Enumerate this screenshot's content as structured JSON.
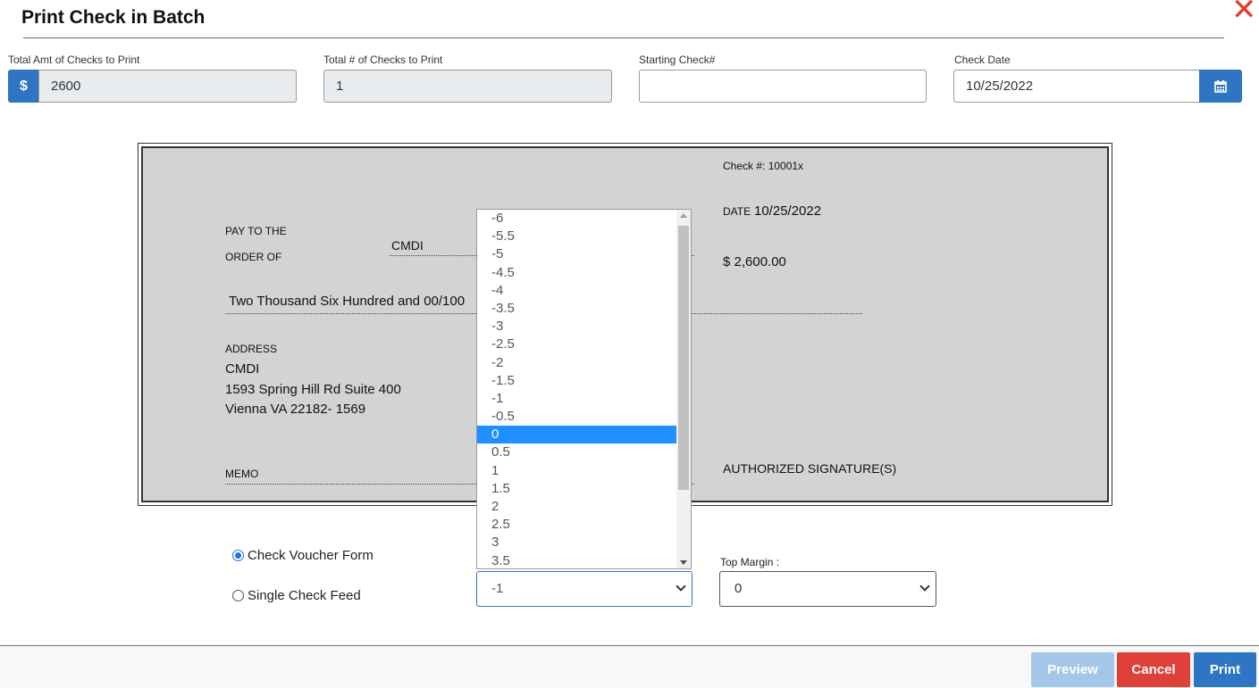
{
  "dialog": {
    "title": "Print Check in Batch",
    "close_glyph": "✕",
    "accent_color": "#2e76c4"
  },
  "fields": {
    "total_amt": {
      "label": "Total Amt of Checks to Print",
      "prefix": "$",
      "value": "2600"
    },
    "total_count": {
      "label": "Total # of Checks to Print",
      "value": "1"
    },
    "starting_check": {
      "label": "Starting Check#",
      "value": ""
    },
    "check_date": {
      "label": "Check Date",
      "value": "10/25/2022",
      "icon": "calendar-icon"
    }
  },
  "check": {
    "check_number": "Check #: 10001x",
    "date_label": "DATE",
    "date_value": "10/25/2022",
    "pay_to_line1": "PAY TO THE",
    "pay_to_line2": "ORDER OF",
    "payee": "CMDI",
    "amount": "$ 2,600.00",
    "amount_words": "Two Thousand Six Hundred and 00/100",
    "address_label": "ADDRESS",
    "address_name": "CMDI",
    "address_line1": "1593 Spring Hill Rd Suite 400",
    "address_line2": "Vienna VA 22182- 1569",
    "memo_label": "MEMO",
    "signature_label": "AUTHORIZED SIGNATURE(S)"
  },
  "options": {
    "voucher_label": "Check Voucher Form",
    "voucher_selected": true,
    "single_label": "Single Check Feed",
    "single_selected": false
  },
  "left_margin_select": {
    "value": "-1",
    "open_options": [
      "-6",
      "-5.5",
      "-5",
      "-4.5",
      "-4",
      "-3.5",
      "-3",
      "-2.5",
      "-2",
      "-1.5",
      "-1",
      "-0.5",
      "0",
      "0.5",
      "1",
      "1.5",
      "2",
      "2.5",
      "3",
      "3.5"
    ],
    "highlighted": "0"
  },
  "top_margin": {
    "label": "Top Margin :",
    "value": "0"
  },
  "footer": {
    "preview_label": "Preview",
    "cancel_label": "Cancel",
    "print_label": "Print"
  }
}
